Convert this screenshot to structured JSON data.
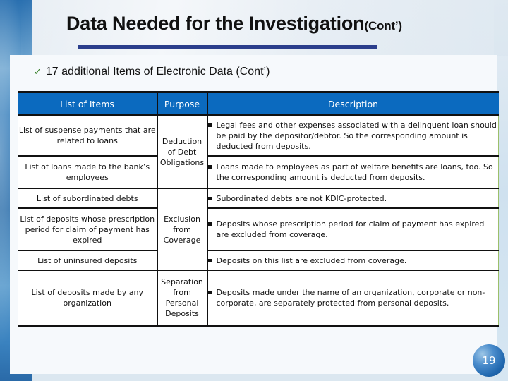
{
  "slide": {
    "title": "Data Needed for the Investigation",
    "title_suffix": "(Cont’)",
    "subtitle": "17 additional Items of Electronic Data (Cont’)",
    "page_number": "19",
    "accent_color": "#0b6abf",
    "purpose_color": "#6a2f7c",
    "rule_color": "#2b3e8c"
  },
  "table": {
    "headers": [
      "List of Items",
      "Purpose",
      "Description"
    ],
    "purposes": [
      "Deduction of Debt Obligations",
      "Exclusion from Coverage",
      "Separation from Personal Deposits"
    ],
    "rows": [
      {
        "item": "List of suspense payments that are related to loans",
        "description": "Legal fees and other expenses associated with a delinquent loan should be paid  by the depositor/debtor. So the corresponding amount is deducted from deposits."
      },
      {
        "item": "List of loans made to the bank’s employees",
        "description": "Loans made to employees as part of welfare benefits are loans, too. So the corresponding amount is deducted from deposits."
      },
      {
        "item": "List of subordinated debts",
        "description": "Subordinated debts are not KDIC-protected."
      },
      {
        "item": "List of deposits whose prescription period for claim of payment has expired",
        "description": "Deposits whose prescription period for claim of payment has expired are excluded  from coverage."
      },
      {
        "item": "List of uninsured deposits",
        "description": "Deposits on this list are excluded from coverage."
      },
      {
        "item": "List of deposits made by any organization",
        "description": "Deposits made under the name of an organization, corporate or non-corporate, are separately protected from personal deposits."
      }
    ]
  }
}
